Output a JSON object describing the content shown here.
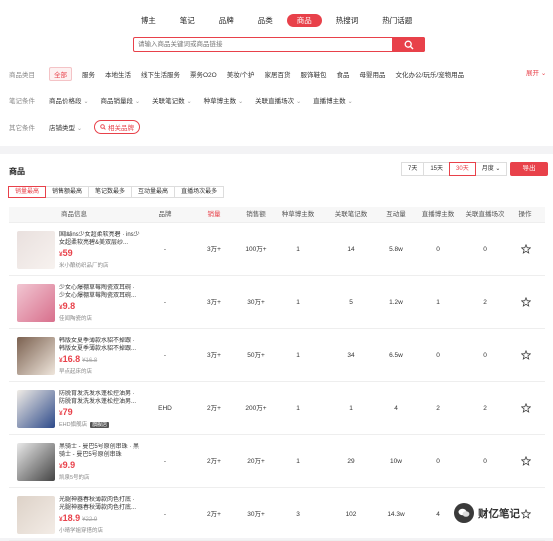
{
  "nav": {
    "tabs": [
      "博主",
      "笔记",
      "品牌",
      "品类",
      "商品",
      "热搜词",
      "热门话题"
    ],
    "active": "商品"
  },
  "search": {
    "placeholder": "请输入商品关键词或商品链接"
  },
  "filters": {
    "category_label": "商品类目",
    "categories": [
      "全部",
      "服务",
      "本地生活",
      "线下生活服务",
      "票务O2O",
      "美妆/个护",
      "家居百货",
      "服饰鞋包",
      "食品",
      "母婴用品",
      "文化办公/玩乐/宠物用品"
    ],
    "more_label": "展开",
    "notes_label": "笔记条件",
    "notes_dropdowns": [
      "商品价格段",
      "商品销量段",
      "关联笔记数",
      "种草博主数",
      "关联直播场次",
      "直播博主数"
    ],
    "other_label": "其它条件",
    "store_type": "店铺类型",
    "brand_pill": "相关品牌"
  },
  "panel": {
    "title": "商品",
    "ranges": [
      "7天",
      "15天",
      "30天"
    ],
    "range_selected": "30天",
    "range_dropdown": "月度",
    "export_label": "导出",
    "sort_tabs": [
      "销量最高",
      "销售额最高",
      "笔记数最多",
      "互动量最高",
      "直播场次最多"
    ],
    "sort_selected": "销量最高"
  },
  "columns": [
    "商品信息",
    "品牌",
    "销量",
    "销售额",
    "种草博主数",
    "关联笔记数",
    "互动量",
    "直播博主数",
    "关联直播场次",
    "操作"
  ],
  "rows": [
    {
      "name": "国围ins少女超柔软亮碧 · ins少女超柔软亮碧&美双层纱...",
      "price": "59",
      "old_price": "",
      "shop": "米小酿纺织品厂的店",
      "tag": "",
      "brand": "-",
      "sales": "3万+",
      "revenue": "100万+",
      "bloggers": "1",
      "notes": "14",
      "engagement": "5.8w",
      "live_bloggers": "0",
      "live_sessions": "0"
    },
    {
      "name": "少女心爆棚草莓陶瓷双耳碗 · 少女心爆棚草莓陶瓷双耳碗...",
      "price": "9.8",
      "old_price": "",
      "shop": "佳闻陶瓷的店",
      "tag": "",
      "brand": "-",
      "sales": "3万+",
      "revenue": "30万+",
      "bloggers": "1",
      "notes": "5",
      "engagement": "1.2w",
      "live_bloggers": "1",
      "live_sessions": "2"
    },
    {
      "name": "韩版女夏季薄款水貂不掉跟 · 韩版女夏季薄款水貂不掉跟...",
      "price": "16.8",
      "old_price": "16.8",
      "shop": "早点起床的店",
      "tag": "",
      "brand": "-",
      "sales": "3万+",
      "revenue": "50万+",
      "bloggers": "1",
      "notes": "34",
      "engagement": "6.5w",
      "live_bloggers": "0",
      "live_sessions": "0"
    },
    {
      "name": "防脱育发洗发水蓬松控油男 · 防脱育发洗发水蓬松控油男...",
      "price": "79",
      "old_price": "",
      "shop": "EHD旗舰店",
      "tag": "旗舰店",
      "brand": "EHD",
      "sales": "2万+",
      "revenue": "200万+",
      "bloggers": "1",
      "notes": "1",
      "engagement": "4",
      "live_bloggers": "2",
      "live_sessions": "2"
    },
    {
      "name": "黑骑士 - 曼巴5号原创串珠 · 黑骑士 - 曼巴5号原创串珠",
      "price": "9.9",
      "old_price": "",
      "shop": "凯泉5号的店",
      "tag": "",
      "brand": "-",
      "sales": "2万+",
      "revenue": "20万+",
      "bloggers": "1",
      "notes": "29",
      "engagement": "10w",
      "live_bloggers": "0",
      "live_sessions": "0"
    },
    {
      "name": "光腿神器春秋薄款肉色打底 · 光腿神器春秋薄款肉色打底...",
      "price": "18.9",
      "old_price": "22.9",
      "shop": "小晴学姐穿搭的店",
      "tag": "",
      "brand": "-",
      "sales": "2万+",
      "revenue": "30万+",
      "bloggers": "3",
      "notes": "102",
      "engagement": "14.3w",
      "live_bloggers": "4",
      "live_sessions": "5"
    }
  ],
  "watermark": "财亿笔记",
  "colors": {
    "accent": "#e8414a"
  },
  "icons": {
    "search": "search-icon",
    "star": "star-icon",
    "brand": "search-icon"
  }
}
